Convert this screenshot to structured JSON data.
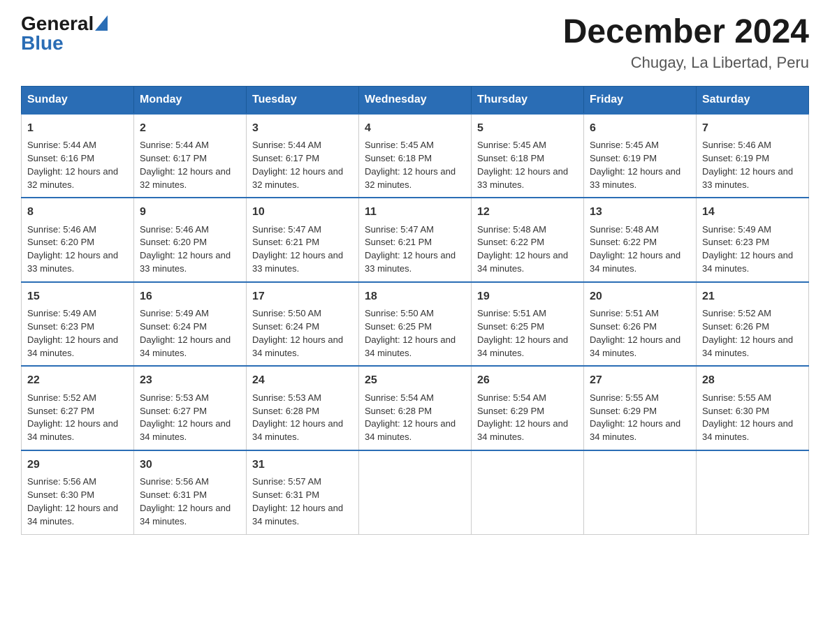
{
  "logo": {
    "general": "General",
    "blue": "Blue"
  },
  "title": "December 2024",
  "subtitle": "Chugay, La Libertad, Peru",
  "days_of_week": [
    "Sunday",
    "Monday",
    "Tuesday",
    "Wednesday",
    "Thursday",
    "Friday",
    "Saturday"
  ],
  "weeks": [
    [
      {
        "day": "1",
        "sunrise": "5:44 AM",
        "sunset": "6:16 PM",
        "daylight": "12 hours and 32 minutes."
      },
      {
        "day": "2",
        "sunrise": "5:44 AM",
        "sunset": "6:17 PM",
        "daylight": "12 hours and 32 minutes."
      },
      {
        "day": "3",
        "sunrise": "5:44 AM",
        "sunset": "6:17 PM",
        "daylight": "12 hours and 32 minutes."
      },
      {
        "day": "4",
        "sunrise": "5:45 AM",
        "sunset": "6:18 PM",
        "daylight": "12 hours and 32 minutes."
      },
      {
        "day": "5",
        "sunrise": "5:45 AM",
        "sunset": "6:18 PM",
        "daylight": "12 hours and 33 minutes."
      },
      {
        "day": "6",
        "sunrise": "5:45 AM",
        "sunset": "6:19 PM",
        "daylight": "12 hours and 33 minutes."
      },
      {
        "day": "7",
        "sunrise": "5:46 AM",
        "sunset": "6:19 PM",
        "daylight": "12 hours and 33 minutes."
      }
    ],
    [
      {
        "day": "8",
        "sunrise": "5:46 AM",
        "sunset": "6:20 PM",
        "daylight": "12 hours and 33 minutes."
      },
      {
        "day": "9",
        "sunrise": "5:46 AM",
        "sunset": "6:20 PM",
        "daylight": "12 hours and 33 minutes."
      },
      {
        "day": "10",
        "sunrise": "5:47 AM",
        "sunset": "6:21 PM",
        "daylight": "12 hours and 33 minutes."
      },
      {
        "day": "11",
        "sunrise": "5:47 AM",
        "sunset": "6:21 PM",
        "daylight": "12 hours and 33 minutes."
      },
      {
        "day": "12",
        "sunrise": "5:48 AM",
        "sunset": "6:22 PM",
        "daylight": "12 hours and 34 minutes."
      },
      {
        "day": "13",
        "sunrise": "5:48 AM",
        "sunset": "6:22 PM",
        "daylight": "12 hours and 34 minutes."
      },
      {
        "day": "14",
        "sunrise": "5:49 AM",
        "sunset": "6:23 PM",
        "daylight": "12 hours and 34 minutes."
      }
    ],
    [
      {
        "day": "15",
        "sunrise": "5:49 AM",
        "sunset": "6:23 PM",
        "daylight": "12 hours and 34 minutes."
      },
      {
        "day": "16",
        "sunrise": "5:49 AM",
        "sunset": "6:24 PM",
        "daylight": "12 hours and 34 minutes."
      },
      {
        "day": "17",
        "sunrise": "5:50 AM",
        "sunset": "6:24 PM",
        "daylight": "12 hours and 34 minutes."
      },
      {
        "day": "18",
        "sunrise": "5:50 AM",
        "sunset": "6:25 PM",
        "daylight": "12 hours and 34 minutes."
      },
      {
        "day": "19",
        "sunrise": "5:51 AM",
        "sunset": "6:25 PM",
        "daylight": "12 hours and 34 minutes."
      },
      {
        "day": "20",
        "sunrise": "5:51 AM",
        "sunset": "6:26 PM",
        "daylight": "12 hours and 34 minutes."
      },
      {
        "day": "21",
        "sunrise": "5:52 AM",
        "sunset": "6:26 PM",
        "daylight": "12 hours and 34 minutes."
      }
    ],
    [
      {
        "day": "22",
        "sunrise": "5:52 AM",
        "sunset": "6:27 PM",
        "daylight": "12 hours and 34 minutes."
      },
      {
        "day": "23",
        "sunrise": "5:53 AM",
        "sunset": "6:27 PM",
        "daylight": "12 hours and 34 minutes."
      },
      {
        "day": "24",
        "sunrise": "5:53 AM",
        "sunset": "6:28 PM",
        "daylight": "12 hours and 34 minutes."
      },
      {
        "day": "25",
        "sunrise": "5:54 AM",
        "sunset": "6:28 PM",
        "daylight": "12 hours and 34 minutes."
      },
      {
        "day": "26",
        "sunrise": "5:54 AM",
        "sunset": "6:29 PM",
        "daylight": "12 hours and 34 minutes."
      },
      {
        "day": "27",
        "sunrise": "5:55 AM",
        "sunset": "6:29 PM",
        "daylight": "12 hours and 34 minutes."
      },
      {
        "day": "28",
        "sunrise": "5:55 AM",
        "sunset": "6:30 PM",
        "daylight": "12 hours and 34 minutes."
      }
    ],
    [
      {
        "day": "29",
        "sunrise": "5:56 AM",
        "sunset": "6:30 PM",
        "daylight": "12 hours and 34 minutes."
      },
      {
        "day": "30",
        "sunrise": "5:56 AM",
        "sunset": "6:31 PM",
        "daylight": "12 hours and 34 minutes."
      },
      {
        "day": "31",
        "sunrise": "5:57 AM",
        "sunset": "6:31 PM",
        "daylight": "12 hours and 34 minutes."
      },
      null,
      null,
      null,
      null
    ]
  ]
}
